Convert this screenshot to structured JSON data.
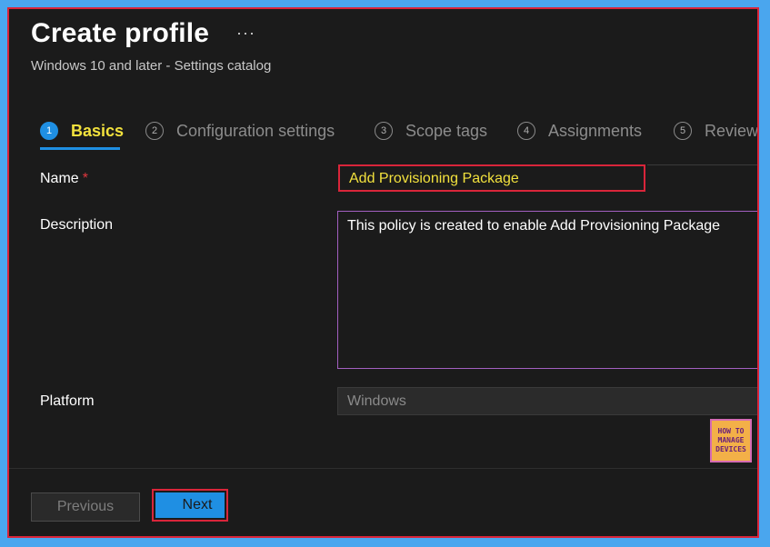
{
  "header": {
    "title": "Create profile",
    "more_label": "···",
    "subtitle": "Windows 10 and later - Settings catalog"
  },
  "steps": [
    {
      "number": "1",
      "label": "Basics",
      "active": true
    },
    {
      "number": "2",
      "label": "Configuration settings",
      "active": false
    },
    {
      "number": "3",
      "label": "Scope tags",
      "active": false
    },
    {
      "number": "4",
      "label": "Assignments",
      "active": false
    },
    {
      "number": "5",
      "label": "Review",
      "active": false
    }
  ],
  "form": {
    "name": {
      "label": "Name",
      "required_mark": "*",
      "value": "Add Provisioning Package"
    },
    "description": {
      "label": "Description",
      "value": "This policy is created to enable Add Provisioning Package"
    },
    "platform": {
      "label": "Platform",
      "value": "Windows"
    }
  },
  "logo": {
    "line1": "HOW TO",
    "line2": "MANAGE",
    "line3": "DEVICES"
  },
  "footer": {
    "previous_label": "Previous",
    "next_label": "Next"
  },
  "colors": {
    "accent": "#1f8fe3",
    "highlight_text": "#f2e13d",
    "annotation_border": "#d9253a",
    "background": "#1b1b1b"
  }
}
